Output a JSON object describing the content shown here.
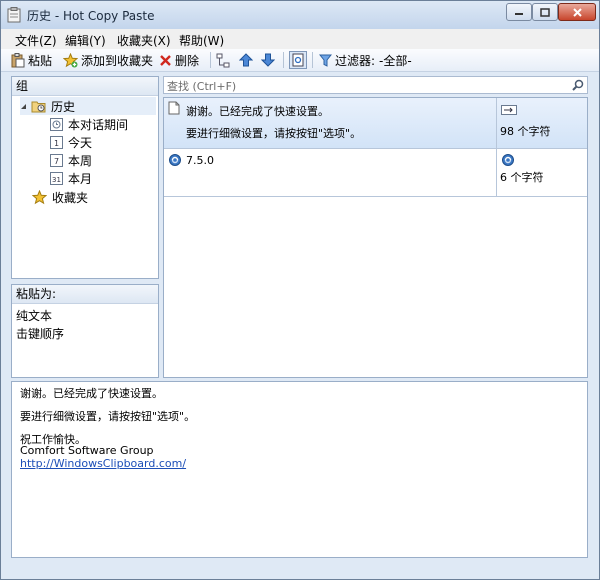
{
  "window": {
    "title": "历史 - Hot Copy Paste"
  },
  "menu": [
    "文件(Z)",
    "编辑(Y)",
    "收藏夹(X)",
    "帮助(W)"
  ],
  "toolbar": {
    "paste": "粘贴",
    "add_favorite": "添加到收藏夹",
    "delete": "删除",
    "filter_label": "过滤器:",
    "filter_value": "-全部-"
  },
  "groups_panel": {
    "title": "组",
    "items": [
      {
        "label": "历史",
        "icon": "history-folder-icon"
      },
      {
        "label": "本对话期间",
        "icon": "session-icon"
      },
      {
        "label": "今天",
        "icon": "calendar-1-icon"
      },
      {
        "label": "本周",
        "icon": "calendar-7-icon"
      },
      {
        "label": "本月",
        "icon": "calendar-31-icon"
      },
      {
        "label": "收藏夹",
        "icon": "star-icon"
      }
    ],
    "calendar_numbers": [
      "1",
      "7",
      "31"
    ]
  },
  "paste_as_panel": {
    "title": "粘贴为:",
    "options": [
      "纯文本",
      "击键顺序"
    ]
  },
  "search": {
    "placeholder": "查找 (Ctrl+F)"
  },
  "clips": [
    {
      "line1": "谢谢。已经完成了快速设置。",
      "line2": "要进行细微设置，请按按钮\"选项\"。",
      "size": "98 个字符"
    },
    {
      "line1": "7.5.0",
      "line2": "",
      "size": "6 个字符"
    }
  ],
  "preview": {
    "line1": "谢谢。已经完成了快速设置。",
    "line2": "要进行细微设置，请按按钮\"选项\"。",
    "line3": "祝工作愉快。",
    "line4": "Comfort Software Group",
    "link": "http://WindowsClipboard.com/"
  },
  "colors": {
    "accent": "#3b6fb6",
    "selection": "#d2e3f7",
    "border": "#9aaec8"
  }
}
